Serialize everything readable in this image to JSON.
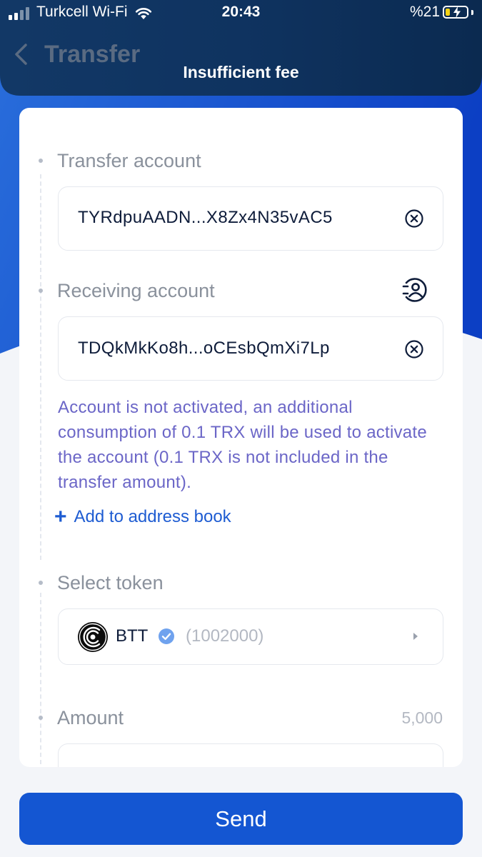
{
  "status_bar": {
    "carrier": "Turkcell Wi-Fi",
    "time": "20:43",
    "battery_percent": "%21",
    "battery_level": 0.21,
    "signal_bars": 2
  },
  "header": {
    "title": "Transfer",
    "back_icon": "chevron-left-icon",
    "toast": "Insufficient fee"
  },
  "form": {
    "transfer_account": {
      "label": "Transfer account",
      "value": "TYRdpuAADN...X8Zx4N35vAC5",
      "clear_icon": "clear-circle-icon"
    },
    "receiving_account": {
      "label": "Receiving account",
      "value": "TDQkMkKo8h...oCEsbQmXi7Lp",
      "contact_icon": "contacts-icon",
      "clear_icon": "clear-circle-icon",
      "notice": "Account is not activated, an additional consumption of 0.1 TRX will be used to activate the account (0.1 TRX is not included in the transfer amount).",
      "add_address_book": "Add to address book"
    },
    "token": {
      "label": "Select token",
      "symbol": "BTT",
      "balance": "(1002000)",
      "logo_icon": "btt-token-icon",
      "verified_icon": "verified-check-icon"
    },
    "amount": {
      "label": "Amount",
      "available": "5,000",
      "value": ""
    }
  },
  "actions": {
    "send_label": "Send"
  },
  "colors": {
    "primary": "#1456d2",
    "notice": "#6b66c7",
    "link": "#1e5cd2",
    "header_dark": "#0e2a52"
  }
}
